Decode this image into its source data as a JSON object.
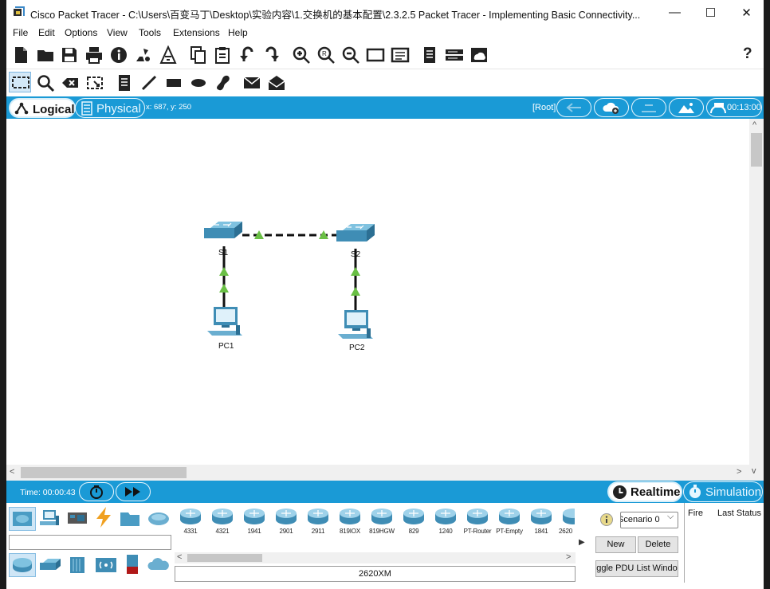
{
  "window": {
    "title": "Cisco Packet Tracer - C:\\Users\\百变马丁\\Desktop\\实验内容\\1.交换机的基本配置\\2.3.2.5 Packet Tracer - Implementing Basic Connectivity...",
    "minimize": "—",
    "maximize": "☐",
    "close": "✕"
  },
  "menu": [
    "File",
    "Edit",
    "Options",
    "View",
    "Tools",
    "Extensions",
    "Help"
  ],
  "toolbar": {
    "main_icons": [
      "new-file-icon",
      "open-folder-icon",
      "save-icon",
      "print-icon",
      "info-icon",
      "activity-wizard-icon",
      "custom-device-icon",
      "copy-icon",
      "paste-icon",
      "undo-icon",
      "redo-icon",
      "zoom-in-icon",
      "zoom-reset-icon",
      "zoom-out-icon",
      "drawing-palette-icon",
      "custom-device-dialog-icon",
      "view-command-log-icon",
      "device-dialog-icon",
      "cluster-icon"
    ],
    "help": "?",
    "tool_icons": [
      "select-icon",
      "inspect-icon",
      "delete-icon",
      "resize-icon",
      "note-icon",
      "line-icon",
      "rectangle-icon",
      "ellipse-icon",
      "freeform-icon",
      "simple-pdu-icon",
      "complex-pdu-icon"
    ]
  },
  "workspace": {
    "logical_label": "Logical",
    "physical_label": "Physical",
    "coordinates": "x: 687, y: 250",
    "root_label": "[Root]",
    "time": "00:13:00"
  },
  "topology": {
    "devices": [
      {
        "id": "S1",
        "label": "S1",
        "type": "switch"
      },
      {
        "id": "S2",
        "label": "S2",
        "type": "switch"
      },
      {
        "id": "PC1",
        "label": "PC1",
        "type": "pc"
      },
      {
        "id": "PC2",
        "label": "PC2",
        "type": "pc"
      }
    ],
    "links": [
      {
        "from": "S1",
        "to": "S2",
        "style": "crossover",
        "status": "up"
      },
      {
        "from": "S1",
        "to": "PC1",
        "style": "straight",
        "status": "up"
      },
      {
        "from": "S2",
        "to": "PC2",
        "style": "straight",
        "status": "up"
      }
    ],
    "link_up_color": "#6abf45"
  },
  "simulation": {
    "time_label": "Time: 00:00:43",
    "realtime_label": "Realtime",
    "simulation_label": "Simulation"
  },
  "device_panel": {
    "categories": [
      "network-devices-icon",
      "end-devices-icon",
      "components-icon",
      "connections-icon",
      "miscellaneous-icon",
      "multiuser-icon"
    ],
    "subcategories": [
      "routers-icon",
      "switches-icon",
      "hubs-icon",
      "wireless-devices-icon",
      "security-icon",
      "wan-emulation-icon"
    ],
    "models": [
      "4331",
      "4321",
      "1941",
      "2901",
      "2911",
      "819IOX",
      "819HGW",
      "829",
      "1240",
      "PT-Router",
      "PT-Empty",
      "1841",
      "2620"
    ],
    "selected_model": "2620XM"
  },
  "scenario": {
    "selected": "Scenario 0",
    "new_label": "New",
    "delete_label": "Delete",
    "toggle_label": "ggle PDU List Windo",
    "columns": [
      "Fire",
      "Last Status"
    ]
  },
  "colors": {
    "accent": "#1a9ad6",
    "device_blue": "#4a9cc4"
  }
}
